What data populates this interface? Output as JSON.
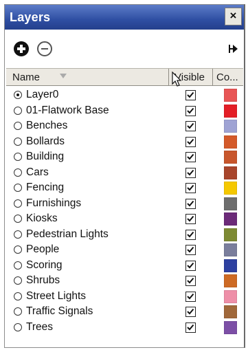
{
  "window": {
    "title": "Layers",
    "close_label": "×"
  },
  "toolbar": {
    "add_icon": "add-layer-icon",
    "remove_icon": "remove-layer-icon",
    "details_icon": "details-arrow-icon"
  },
  "header": {
    "name": "Name",
    "visible": "Visible",
    "color": "Co..."
  },
  "layers": [
    {
      "name": "Layer0",
      "active": true,
      "visible": true,
      "color": "#e85555"
    },
    {
      "name": "01-Flatwork Base",
      "active": false,
      "visible": true,
      "color": "#e31e26"
    },
    {
      "name": "Benches",
      "active": false,
      "visible": true,
      "color": "#9fa3d4"
    },
    {
      "name": "Bollards",
      "active": false,
      "visible": true,
      "color": "#d45a2a"
    },
    {
      "name": "Building",
      "active": false,
      "visible": true,
      "color": "#c8562c"
    },
    {
      "name": "Cars",
      "active": false,
      "visible": true,
      "color": "#a8452c"
    },
    {
      "name": "Fencing",
      "active": false,
      "visible": true,
      "color": "#f5c800"
    },
    {
      "name": "Furnishings",
      "active": false,
      "visible": true,
      "color": "#6e6e6e"
    },
    {
      "name": "Kiosks",
      "active": false,
      "visible": true,
      "color": "#6b2a78"
    },
    {
      "name": "Pedestrian Lights",
      "active": false,
      "visible": true,
      "color": "#7d8a33"
    },
    {
      "name": "People",
      "active": false,
      "visible": true,
      "color": "#7a7e9c"
    },
    {
      "name": "Scoring",
      "active": false,
      "visible": true,
      "color": "#2d40a0"
    },
    {
      "name": "Shrubs",
      "active": false,
      "visible": true,
      "color": "#cd6a24"
    },
    {
      "name": "Street Lights",
      "active": false,
      "visible": true,
      "color": "#ee8fa8"
    },
    {
      "name": "Traffic Signals",
      "active": false,
      "visible": true,
      "color": "#a0683a"
    },
    {
      "name": "Trees",
      "active": false,
      "visible": true,
      "color": "#7c4fa6"
    }
  ]
}
